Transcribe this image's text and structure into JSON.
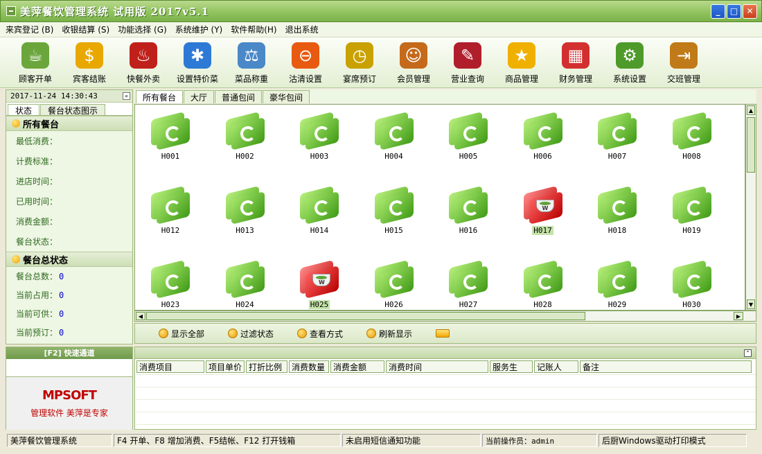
{
  "window": {
    "title": "美萍餐饮管理系统 试用版 2017v5.1",
    "controls": [
      "_",
      "□",
      "✕"
    ]
  },
  "menu": [
    "来宾登记 (B)",
    "收银结算 (S)",
    "功能选择 (G)",
    "系统维护 (Y)",
    "软件帮助(H)",
    "退出系统"
  ],
  "toolbar": [
    {
      "label": "顾客开单",
      "icon": "teacup-icon",
      "color": "#6aa63c",
      "glyph": "☕"
    },
    {
      "label": "宾客结账",
      "icon": "dollar-arrow-icon",
      "color": "#e8a800",
      "glyph": "$"
    },
    {
      "label": "快餐外卖",
      "icon": "takeout-icon",
      "color": "#c0201a",
      "glyph": "♨"
    },
    {
      "label": "设置特价菜",
      "icon": "gear-star-icon",
      "color": "#2d7ad6",
      "glyph": "✱"
    },
    {
      "label": "菜品称重",
      "icon": "scale-icon",
      "color": "#4a88c8",
      "glyph": "⚖"
    },
    {
      "label": "沽清设置",
      "icon": "no-entry-icon",
      "color": "#e85a10",
      "glyph": "⊖"
    },
    {
      "label": "宴席预订",
      "icon": "clock-icon",
      "color": "#c9a100",
      "glyph": "◷"
    },
    {
      "label": "会员管理",
      "icon": "members-icon",
      "color": "#c46a1a",
      "glyph": "☺"
    },
    {
      "label": "营业查询",
      "icon": "book-search-icon",
      "color": "#b01e2c",
      "glyph": "✎"
    },
    {
      "label": "商品管理",
      "icon": "star-icon",
      "color": "#f0b000",
      "glyph": "★"
    },
    {
      "label": "财务管理",
      "icon": "calculator-icon",
      "color": "#d23030",
      "glyph": "▦"
    },
    {
      "label": "系统设置",
      "icon": "gears-icon",
      "color": "#4e9a2a",
      "glyph": "⚙"
    },
    {
      "label": "交班管理",
      "icon": "exit-door-icon",
      "color": "#c07a18",
      "glyph": "⇥"
    }
  ],
  "left": {
    "datetime": "2017-11-24 14:30:43",
    "tabs": [
      "状态",
      "餐台状态图示"
    ],
    "section1_title": "所有餐台",
    "fields1": [
      "最低消费：",
      "计费标准：",
      "进店时间：",
      "已用时间：",
      "消费金额：",
      "餐台状态："
    ],
    "section2_title": "餐台总状态",
    "fields2": [
      {
        "label": "餐台总数：",
        "value": "0"
      },
      {
        "label": "当前占用：",
        "value": "0"
      },
      {
        "label": "当前可供：",
        "value": "0"
      },
      {
        "label": "当前预订：",
        "value": "0"
      }
    ]
  },
  "quick": {
    "title": "[F2] 快速通道",
    "logo": "MPSOFT",
    "slogan": "管理软件 美萍是专家"
  },
  "tabs": [
    "所有餐台",
    "大厅",
    "普通包间",
    "豪华包间"
  ],
  "tables": [
    {
      "id": "H001",
      "status": "free"
    },
    {
      "id": "H002",
      "status": "free"
    },
    {
      "id": "H003",
      "status": "free"
    },
    {
      "id": "H004",
      "status": "free"
    },
    {
      "id": "H005",
      "status": "free"
    },
    {
      "id": "H006",
      "status": "free"
    },
    {
      "id": "H007",
      "status": "free"
    },
    {
      "id": "H008",
      "status": "free"
    },
    {
      "id": "H012",
      "status": "free"
    },
    {
      "id": "H013",
      "status": "free"
    },
    {
      "id": "H014",
      "status": "free"
    },
    {
      "id": "H015",
      "status": "free"
    },
    {
      "id": "H016",
      "status": "free"
    },
    {
      "id": "H017",
      "status": "occupied"
    },
    {
      "id": "H018",
      "status": "free"
    },
    {
      "id": "H019",
      "status": "free"
    },
    {
      "id": "H023",
      "status": "free"
    },
    {
      "id": "H024",
      "status": "free"
    },
    {
      "id": "H025",
      "status": "occupied"
    },
    {
      "id": "H026",
      "status": "free"
    },
    {
      "id": "H027",
      "status": "free"
    },
    {
      "id": "H028",
      "status": "free"
    },
    {
      "id": "H029",
      "status": "free"
    },
    {
      "id": "H030",
      "status": "free"
    }
  ],
  "actions": [
    "显示全部",
    "过滤状态",
    "查看方式",
    "刷新显示"
  ],
  "consumption_columns": [
    "消费项目",
    "项目单价",
    "打折比例",
    "消费数量",
    "消费金额",
    "消费时间",
    "服务生",
    "记账人",
    "备注"
  ],
  "status": [
    "美萍餐饮管理系统",
    "F4 开单、F8 增加消费、F5结帐、F12 打开钱箱",
    "未启用短信通知功能",
    "当前操作员：admin",
    "后厨Windows驱动打印模式"
  ],
  "colors": {
    "free": "#4caa1c",
    "occupied": "#c20c0c",
    "accent_green": "#8ec25c"
  }
}
